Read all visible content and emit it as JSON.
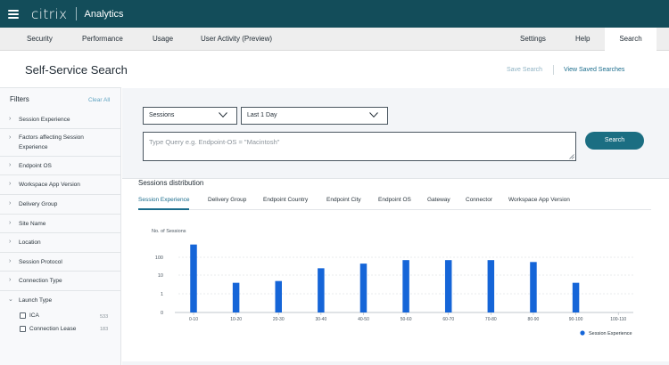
{
  "app": {
    "brand": "citrix",
    "product": "Analytics"
  },
  "nav": {
    "left": [
      {
        "label": "Security"
      },
      {
        "label": "Performance"
      },
      {
        "label": "Usage"
      },
      {
        "label": "User Activity (Preview)"
      }
    ],
    "right": [
      {
        "label": "Settings"
      },
      {
        "label": "Help"
      },
      {
        "label": "Search",
        "active": true
      }
    ]
  },
  "page": {
    "title": "Self-Service Search",
    "save_search": "Save Search",
    "view_saved": "View Saved Searches"
  },
  "filters": {
    "title": "Filters",
    "clear_all": "Clear All",
    "items": [
      {
        "label": "Session Experience"
      },
      {
        "label": "Factors affecting Session Experience"
      },
      {
        "label": "Endpoint OS"
      },
      {
        "label": "Workspace App Version"
      },
      {
        "label": "Delivery Group"
      },
      {
        "label": "Site Name"
      },
      {
        "label": "Location"
      },
      {
        "label": "Session Protocol"
      },
      {
        "label": "Connection Type"
      },
      {
        "label": "Launch Type",
        "expanded": true
      }
    ],
    "launch_type_options": [
      {
        "label": "ICA",
        "count": "533",
        "checked": false
      },
      {
        "label": "Connection Lease",
        "count": "183",
        "checked": false
      }
    ]
  },
  "query": {
    "data_source": "Sessions",
    "time_range": "Last 1 Day",
    "placeholder": "Type Query e.g.  Endpoint-OS = \"Macintosh\"",
    "search_label": "Search"
  },
  "distribution": {
    "title": "Sessions distribution",
    "tabs": [
      {
        "label": "Session Experience",
        "active": true
      },
      {
        "label": "Delivery Group"
      },
      {
        "label": "Endpoint Country"
      },
      {
        "label": "Endpoint City"
      },
      {
        "label": "Endpoint OS"
      },
      {
        "label": "Gateway"
      },
      {
        "label": "Connector"
      },
      {
        "label": "Workspace App Version"
      }
    ]
  },
  "chart_data": {
    "type": "bar",
    "ylabel": "No. of Sessions",
    "yscale": "log",
    "yticks": [
      "0",
      "1",
      "10",
      "100"
    ],
    "categories": [
      "0-10",
      "10-20",
      "20-30",
      "30-40",
      "40-50",
      "50-60",
      "60-70",
      "70-80",
      "80-90",
      "90-100",
      "100-110"
    ],
    "series": [
      {
        "name": "Session Experience",
        "values": [
          500,
          4,
          5,
          25,
          45,
          70,
          70,
          70,
          55,
          4,
          0
        ]
      }
    ],
    "legend": "bottom-right",
    "color": "#1565d8",
    "grid": true
  },
  "colors": {
    "topbar": "#134d5a",
    "accent": "#1a6c8c",
    "button": "#1b6e82",
    "bar": "#1565d8"
  }
}
